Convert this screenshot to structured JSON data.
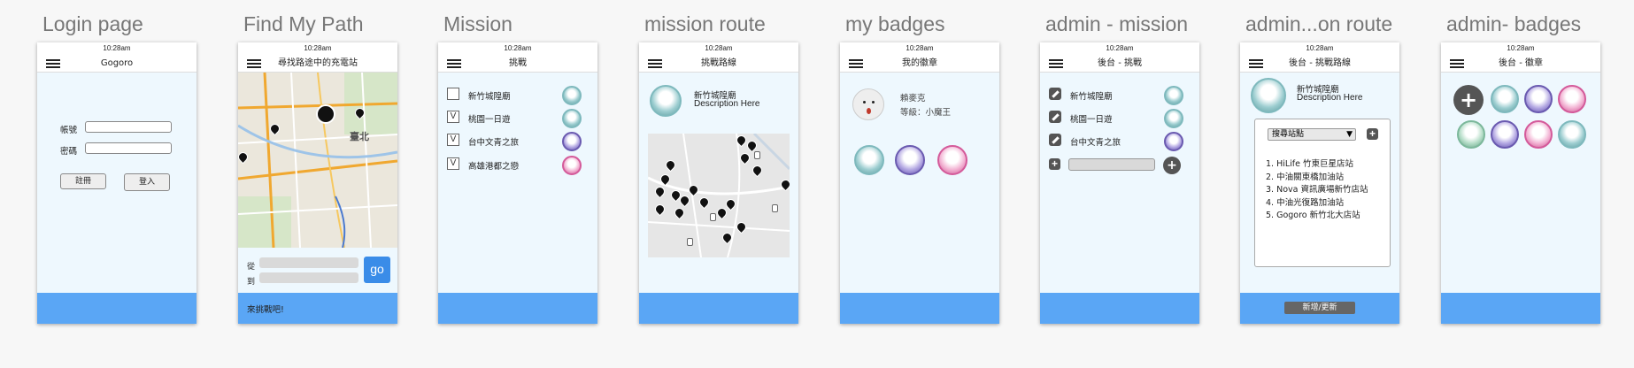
{
  "status_time": "10:28am",
  "screens": [
    {
      "title": "Login page",
      "nav_title": "Gogoro",
      "account_label": "帳號",
      "password_label": "密碼",
      "register_label": "註冊",
      "login_label": "登入"
    },
    {
      "title": "Find My Path",
      "nav_title": "尋找路途中的充電站",
      "map_label": "臺北",
      "from_label": "從",
      "to_label": "到",
      "go_label": "go",
      "footer_text": "來挑戰吧!"
    },
    {
      "title": "Mission",
      "nav_title": "挑戰",
      "items": [
        {
          "check": "",
          "label": "新竹城隍廟",
          "badge": "teal"
        },
        {
          "check": "V",
          "label": "桃園一日遊",
          "badge": "teal"
        },
        {
          "check": "V",
          "label": "台中文青之旅",
          "badge": "purple"
        },
        {
          "check": "V",
          "label": "高雄港都之戀",
          "badge": "pink"
        }
      ]
    },
    {
      "title": "mission route",
      "nav_title": "挑戰路線",
      "mission_name": "新竹城隍廟",
      "description": "Description Here"
    },
    {
      "title": "my badges",
      "nav_title": "我的徽章",
      "username": "賴麥克",
      "level": "等級：小魔王"
    },
    {
      "title": "admin - mission",
      "nav_title": "後台 - 挑戰",
      "items": [
        {
          "label": "新竹城隍廟",
          "badge": "teal"
        },
        {
          "label": "桃園一日遊",
          "badge": "teal"
        },
        {
          "label": "台中文青之旅",
          "badge": "purple"
        }
      ]
    },
    {
      "title": "admin...on route",
      "nav_title": "後台 - 挑戰路線",
      "mission_name": "新竹城隍廟",
      "description": "Description Here",
      "search_label": "搜尋站點",
      "stations": [
        "1. HiLife 竹東巨星店站",
        "2. 中油關東橋加油站",
        "3. Nova 資訊廣場新竹店站",
        "4. 中油光復路加油站",
        "5. Gogoro 新竹北大店站"
      ],
      "submit_label": "新增/更新"
    },
    {
      "title": "admin- badges",
      "nav_title": "後台 - 徽章"
    }
  ],
  "colors": {
    "footer": "#5aa6f5",
    "phone_bg": "#eef8fe",
    "title_text": "#777777"
  }
}
